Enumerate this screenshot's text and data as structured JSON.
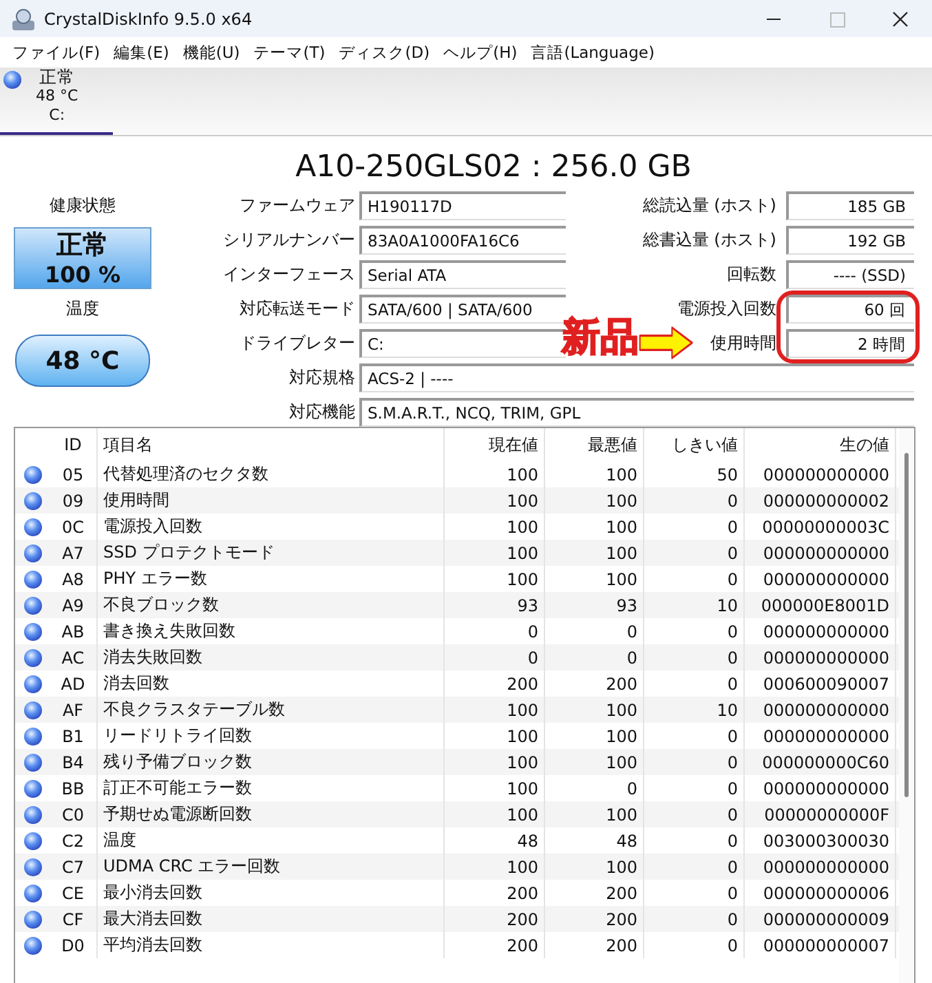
{
  "window": {
    "title": "CrystalDiskInfo 9.5.0 x64"
  },
  "menu": [
    "ファイル(F)",
    "編集(E)",
    "機能(U)",
    "テーマ(T)",
    "ディスク(D)",
    "ヘルプ(H)",
    "言語(Language)"
  ],
  "disk_tabs": [
    {
      "status": "正常",
      "temperature": "48 °C",
      "drive": "C:",
      "selected": true
    }
  ],
  "model": "A10-250GLS02 : 256.0 GB",
  "health": {
    "label": "健康状態",
    "status": "正常",
    "percent": "100 %"
  },
  "temperature": {
    "label": "温度",
    "value": "48 °C"
  },
  "info_left": [
    {
      "label": "ファームウェア",
      "value": "H190117D"
    },
    {
      "label": "シリアルナンバー",
      "value": "83A0A1000FA16C6"
    },
    {
      "label": "インターフェース",
      "value": "Serial ATA"
    },
    {
      "label": "対応転送モード",
      "value": "SATA/600 | SATA/600"
    },
    {
      "label": "ドライブレター",
      "value": "C:"
    },
    {
      "label": "対応規格",
      "value": "ACS-2 | ----"
    },
    {
      "label": "対応機能",
      "value": "S.M.A.R.T., NCQ, TRIM, GPL"
    }
  ],
  "info_right": [
    {
      "label": "総読込量 (ホスト)",
      "value": "185 GB"
    },
    {
      "label": "総書込量 (ホスト)",
      "value": "192 GB"
    },
    {
      "label": "回転数",
      "value": "---- (SSD)"
    },
    {
      "label": "電源投入回数",
      "value": "60 回"
    },
    {
      "label": "使用時間",
      "value": "2 時間"
    }
  ],
  "annotation": {
    "text": "新品"
  },
  "table": {
    "columns": [
      "ID",
      "項目名",
      "現在値",
      "最悪値",
      "しきい値",
      "生の値"
    ],
    "rows": [
      [
        "05",
        "代替処理済のセクタ数",
        "100",
        "100",
        "50",
        "000000000000"
      ],
      [
        "09",
        "使用時間",
        "100",
        "100",
        "0",
        "000000000002"
      ],
      [
        "0C",
        "電源投入回数",
        "100",
        "100",
        "0",
        "00000000003C"
      ],
      [
        "A7",
        "SSD プロテクトモード",
        "100",
        "100",
        "0",
        "000000000000"
      ],
      [
        "A8",
        "PHY エラー数",
        "100",
        "100",
        "0",
        "000000000000"
      ],
      [
        "A9",
        "不良ブロック数",
        "93",
        "93",
        "10",
        "000000E8001D"
      ],
      [
        "AB",
        "書き換え失敗回数",
        "0",
        "0",
        "0",
        "000000000000"
      ],
      [
        "AC",
        "消去失敗回数",
        "0",
        "0",
        "0",
        "000000000000"
      ],
      [
        "AD",
        "消去回数",
        "200",
        "200",
        "0",
        "000600090007"
      ],
      [
        "AF",
        "不良クラスタテーブル数",
        "100",
        "100",
        "10",
        "000000000000"
      ],
      [
        "B1",
        "リードリトライ回数",
        "100",
        "100",
        "0",
        "000000000000"
      ],
      [
        "B4",
        "残り予備ブロック数",
        "100",
        "100",
        "0",
        "000000000C60"
      ],
      [
        "BB",
        "訂正不可能エラー数",
        "100",
        "0",
        "0",
        "000000000000"
      ],
      [
        "C0",
        "予期せぬ電源断回数",
        "100",
        "100",
        "0",
        "00000000000F"
      ],
      [
        "C2",
        "温度",
        "48",
        "48",
        "0",
        "003000300030"
      ],
      [
        "C7",
        "UDMA CRC エラー回数",
        "100",
        "100",
        "0",
        "000000000000"
      ],
      [
        "CE",
        "最小消去回数",
        "200",
        "200",
        "0",
        "000000000006"
      ],
      [
        "CF",
        "最大消去回数",
        "200",
        "200",
        "0",
        "000000000009"
      ],
      [
        "D0",
        "平均消去回数",
        "200",
        "200",
        "0",
        "000000000007"
      ]
    ]
  }
}
